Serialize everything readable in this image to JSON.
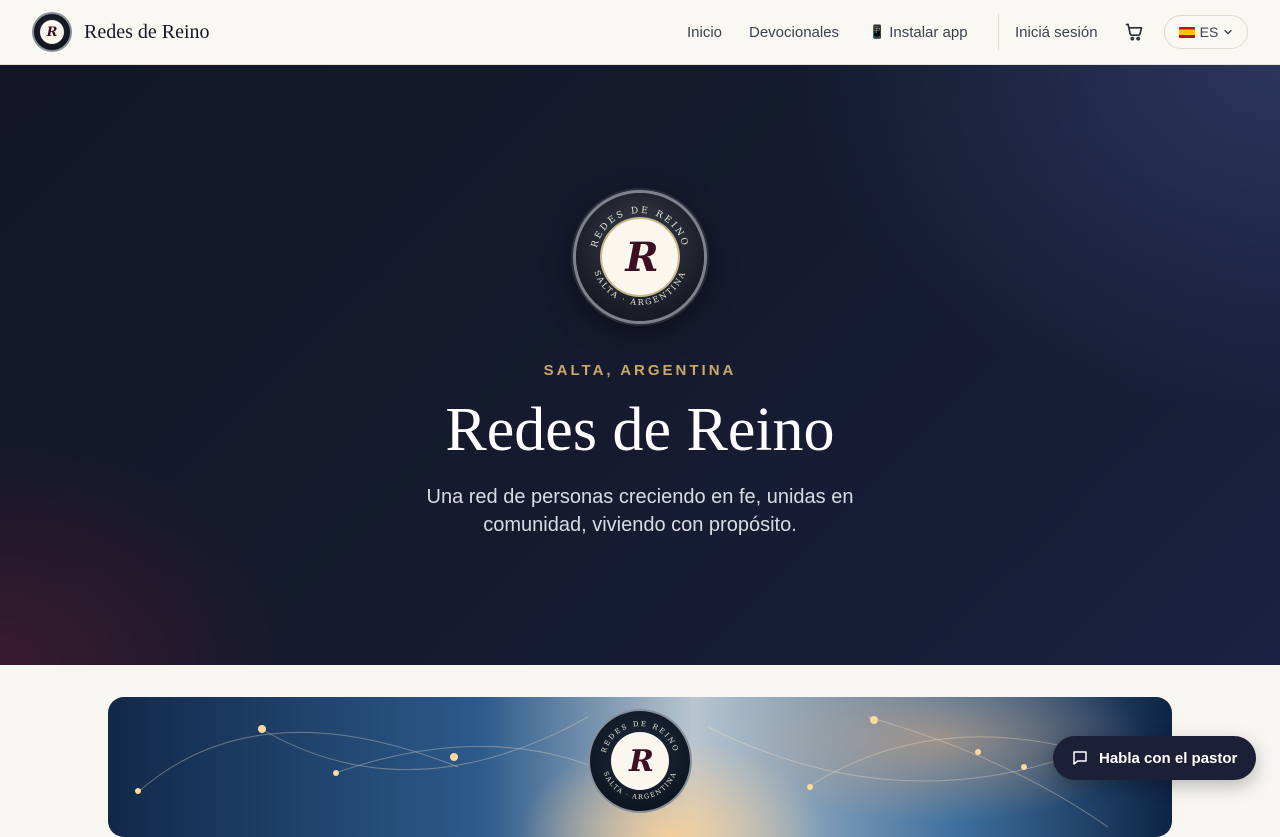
{
  "header": {
    "brand_name": "Redes de Reino",
    "brand_logo_letters": "R",
    "nav": [
      {
        "label": "Inicio"
      },
      {
        "label": "Devocionales"
      },
      {
        "label": "Instalar app",
        "icon": "📱"
      }
    ],
    "login_label": "Iniciá sesión",
    "language": {
      "flag": "es",
      "code": "ES"
    }
  },
  "hero": {
    "emblem_ring_text_top": "REDES DE REINO",
    "emblem_ring_text_bottom": "SALTA · ARGENTINA",
    "emblem_letters": "R",
    "eyebrow": "SALTA, ARGENTINA",
    "title": "Redes de Reino",
    "subtitle": "Una red de personas creciendo en fe, unidas en comunidad, viviendo con propósito."
  },
  "banner": {
    "emblem_ring_text_top": "REDES DE REINO",
    "emblem_ring_text_bottom": "SALTA · ARGENTINA",
    "emblem_letters": "R"
  },
  "chat": {
    "label": "Habla con el pastor"
  },
  "colors": {
    "eyebrow": "#c9a86a",
    "hero_bg": "#151a2e",
    "page_bg": "#f8f6f1",
    "chat_bg": "#1c2036"
  }
}
